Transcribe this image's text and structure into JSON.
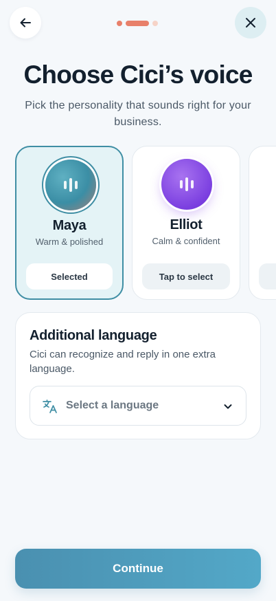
{
  "header": {
    "back_icon": "arrow-left-icon",
    "close_icon": "close-icon",
    "progress": {
      "current_step": 2,
      "total_steps": 3
    }
  },
  "title": "Choose Cici’s voice",
  "subtitle": "Pick the personality that sounds right for your business.",
  "voices": [
    {
      "name": "Maya",
      "description": "Warm & polished",
      "button_label": "Selected",
      "selected": true
    },
    {
      "name": "Elliot",
      "description": "Calm & confident",
      "button_label": "Tap to select",
      "selected": false
    }
  ],
  "language": {
    "title": "Additional language",
    "description": "Cici can recognize and reply in one extra language.",
    "placeholder": "Select a language",
    "icon": "translate-icon",
    "chevron_icon": "chevron-down-icon"
  },
  "continue_label": "Continue",
  "colors": {
    "accent": "#3f8ea4",
    "progress_active": "#e8806a",
    "progress_inactive": "#f6d3c7",
    "maya_avatar": "#3b8ea5",
    "elliot_avatar": "#7b3fe0"
  }
}
